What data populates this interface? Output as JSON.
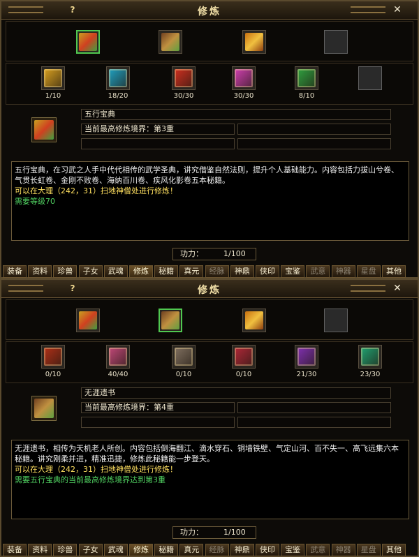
{
  "tabs": [
    {
      "label": "装备",
      "state": "normal"
    },
    {
      "label": "资料",
      "state": "normal"
    },
    {
      "label": "珍兽",
      "state": "normal"
    },
    {
      "label": "子女",
      "state": "normal"
    },
    {
      "label": "武魂",
      "state": "normal"
    },
    {
      "label": "修炼",
      "state": "active"
    },
    {
      "label": "秘籍",
      "state": "normal"
    },
    {
      "label": "真元",
      "state": "normal"
    },
    {
      "label": "经脉",
      "state": "disabled"
    },
    {
      "label": "神鼎",
      "state": "normal"
    },
    {
      "label": "侠印",
      "state": "normal"
    },
    {
      "label": "宝鉴",
      "state": "normal"
    },
    {
      "label": "武意",
      "state": "disabled"
    },
    {
      "label": "神器",
      "state": "disabled"
    },
    {
      "label": "星盘",
      "state": "disabled"
    },
    {
      "label": "其他",
      "state": "normal"
    }
  ],
  "panels": [
    {
      "title": "修炼",
      "help_label": "?",
      "close_label": "✕",
      "categories": [
        {
          "icon": "wuxing-book-icon",
          "colors": [
            "#c8a020",
            "#d04020",
            "#40a040"
          ],
          "selected": true
        },
        {
          "icon": "treasure-chest-icon",
          "colors": [
            "#704020",
            "#c09040",
            "#60a040"
          ],
          "selected": false
        },
        {
          "icon": "gold-ingot-chest-icon",
          "colors": [
            "#c87010",
            "#f0c040",
            "#904010"
          ],
          "selected": false
        },
        {
          "icon": "empty-slot",
          "colors": [],
          "selected": false
        }
      ],
      "books": [
        {
          "icon": "yellow-book-icon",
          "color": "#d8a020",
          "count": "1/10"
        },
        {
          "icon": "cyan-book-icon",
          "color": "#20a0c0",
          "count": "18/20"
        },
        {
          "icon": "red-book-icon",
          "color": "#d03020",
          "count": "30/30"
        },
        {
          "icon": "magenta-book-icon",
          "color": "#d040b0",
          "count": "30/30"
        },
        {
          "icon": "green-book-icon",
          "color": "#30a040",
          "count": "8/10"
        },
        {
          "icon": "empty-slot",
          "color": "",
          "count": ""
        }
      ],
      "big_icon": "wuxing-book-icon",
      "big_icon_colors": [
        "#c8a020",
        "#d04020",
        "#40a040"
      ],
      "name": "五行宝典",
      "realm": "当前最高修炼境界：第3重",
      "description": [
        {
          "text": "五行宝典，在习武之人手中代代相传的武学圣典，讲究借鉴自然法则，提升个人基础能力。内容包括力拔山兮卷、气贯长虹卷、金刚不败卷、海纳百川卷、疾风化影卷五本秘籍。",
          "color": "white"
        },
        {
          "text": "可以在大理（242，31）扫地神僧处进行修炼！",
          "color": "yellow"
        },
        {
          "text": "需要等级70",
          "color": "green"
        }
      ],
      "power_label": "功力：",
      "power_value": "1/100"
    },
    {
      "title": "修炼",
      "help_label": "?",
      "close_label": "✕",
      "categories": [
        {
          "icon": "wuxing-book-icon",
          "colors": [
            "#c8a020",
            "#d04020",
            "#40a040"
          ],
          "selected": false
        },
        {
          "icon": "treasure-chest-icon",
          "colors": [
            "#704020",
            "#c09040",
            "#60a040"
          ],
          "selected": true
        },
        {
          "icon": "gold-ingot-chest-icon",
          "colors": [
            "#c87010",
            "#f0c040",
            "#904010"
          ],
          "selected": false
        },
        {
          "icon": "empty-slot",
          "colors": [],
          "selected": false
        }
      ],
      "books": [
        {
          "icon": "red-scroll-icon",
          "color": "#b03018",
          "count": "0/10"
        },
        {
          "icon": "pink-scroll-icon",
          "color": "#c04878",
          "count": "40/40"
        },
        {
          "icon": "grey-scroll-icon",
          "color": "#807060",
          "count": "0/10"
        },
        {
          "icon": "crimson-scroll-icon",
          "color": "#b02838",
          "count": "0/10"
        },
        {
          "icon": "purple-scroll-icon",
          "color": "#8030b0",
          "count": "21/30"
        },
        {
          "icon": "teal-scroll-icon",
          "color": "#20a070",
          "count": "23/30"
        }
      ],
      "big_icon": "treasure-chest-icon",
      "big_icon_colors": [
        "#704020",
        "#c09040",
        "#60a040"
      ],
      "name": "无涯遗书",
      "realm": "当前最高修炼境界：第4重",
      "description": [
        {
          "text": "无涯遗书，相传为天机老人所创。内容包括倒海翻江、滴水穿石、铜墙铁壁、气定山河、百不失一、高飞远集六本秘籍。讲究刚柔并进，精准迅捷，修炼此秘籍能一步登天。",
          "color": "white"
        },
        {
          "text": "可以在大理（242，31）扫地神僧处进行修炼！",
          "color": "yellow"
        },
        {
          "text": "需要五行宝典的当前最高修炼境界达到第3重",
          "color": "green"
        }
      ],
      "power_label": "功力：",
      "power_value": "1/100"
    }
  ]
}
